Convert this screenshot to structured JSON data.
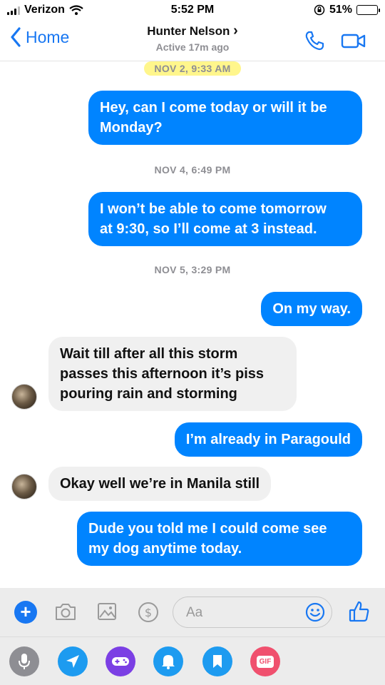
{
  "status_bar": {
    "carrier": "Verizon",
    "time": "5:52 PM",
    "battery_percent": "51%",
    "battery_level": 0.51
  },
  "header": {
    "back_label": "Home",
    "contact_name": "Hunter Nelson",
    "contact_chevron": "›",
    "active_status": "Active 17m ago",
    "icons": [
      "phone-icon",
      "video-camera-icon"
    ],
    "accent_color": "#1877f2"
  },
  "messages": [
    {
      "type": "timestamp",
      "text": "NOV 2, 9:33 AM",
      "highlighted": true
    },
    {
      "type": "outgoing",
      "lines": [
        "Hey, can I come today or will it be",
        "Monday?"
      ]
    },
    {
      "type": "timestamp",
      "text": "NOV 4, 6:49 PM"
    },
    {
      "type": "outgoing",
      "lines": [
        "I won’t be able to come tomorrow",
        "at 9:30, so I’ll come at 3 instead."
      ]
    },
    {
      "type": "timestamp",
      "text": "NOV 5, 3:29 PM"
    },
    {
      "type": "outgoing",
      "lines": [
        "On my way."
      ]
    },
    {
      "type": "incoming",
      "lines": [
        "Wait till  after all this storm",
        "passes this afternoon it’s piss",
        "pouring rain and storming"
      ]
    },
    {
      "type": "outgoing",
      "lines": [
        "I’m already in Paragould"
      ]
    },
    {
      "type": "incoming",
      "lines": [
        "Okay well we’re in Manila still"
      ]
    },
    {
      "type": "outgoing",
      "lines": [
        "Dude you told me I could come see",
        "my dog anytime today."
      ]
    }
  ],
  "colors": {
    "outgoing_bubble": "#0084ff",
    "incoming_bubble": "#f0f0f0",
    "timestamp_highlight": "#fff578"
  },
  "composer": {
    "placeholder": "Aa",
    "icons": [
      "plus-icon",
      "camera-icon",
      "gallery-icon",
      "payment-icon",
      "emoji-icon",
      "thumbs-up-icon"
    ]
  },
  "app_drawer": {
    "apps": [
      {
        "icon": "microphone-icon",
        "color": "#8e8e93"
      },
      {
        "icon": "location-icon",
        "color": "#1d9bf0"
      },
      {
        "icon": "game-controller-icon",
        "color": "#7b3fe4"
      },
      {
        "icon": "bell-icon",
        "color": "#1d9bf0"
      },
      {
        "icon": "bookmark-icon",
        "color": "#1d9bf0"
      },
      {
        "icon": "gif-icon",
        "color": "#f0506e",
        "label": "GIF"
      }
    ]
  }
}
